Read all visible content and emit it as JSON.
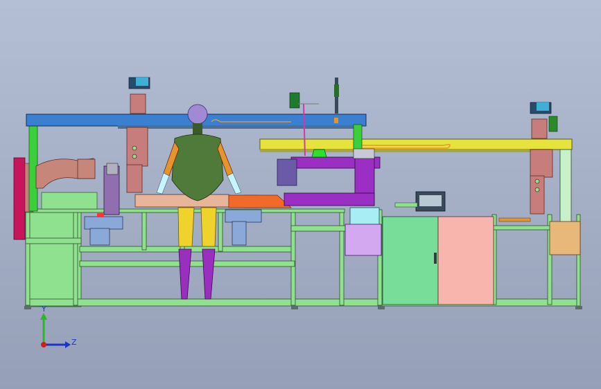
{
  "viewport": {
    "background_top": "#b4bed4",
    "background_bottom": "#959fb7"
  },
  "triad": {
    "y_label": "Y",
    "z_label": "Z",
    "y_color": "#2db52d",
    "z_color": "#1a36c8",
    "origin_color": "#d41c1c"
  },
  "colors": {
    "frame": "#8fe08f",
    "blue_beam": "#3a7fd0",
    "yellow_beam": "#e6e33d",
    "purple_unit": "#9b2fc4",
    "pink_cabinet": "#f7b5ad",
    "green_cabinet": "#79dd9a",
    "mannequin_torso": "#4f7a3a",
    "mannequin_arm": "#e8942a",
    "mannequin_leg_upper": "#f0d22d",
    "mannequin_leg_lower": "#9a2fbf",
    "orange_plate": "#f26a2a"
  }
}
